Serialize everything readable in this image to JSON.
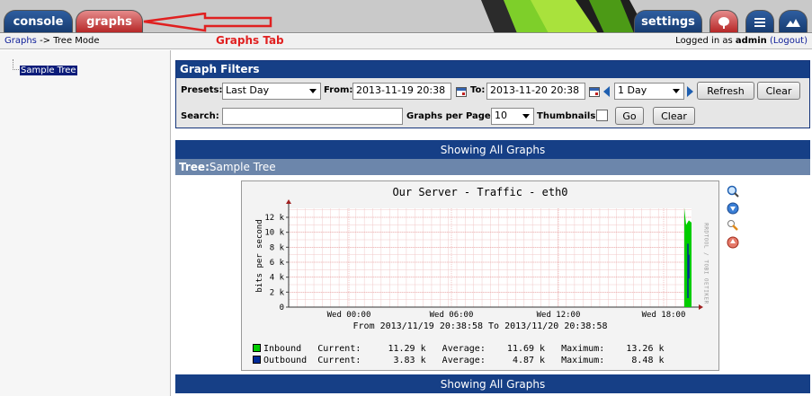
{
  "header": {
    "tabs": {
      "console": "console",
      "graphs": "graphs",
      "settings": "settings"
    },
    "annotation": "Graphs Tab"
  },
  "breadcrumb": {
    "root": "Graphs",
    "separator": "->",
    "current": "Tree Mode"
  },
  "login": {
    "prefix": "Logged in as",
    "user": "admin",
    "logout": "(Logout)"
  },
  "tree": {
    "node": "Sample Tree"
  },
  "filters": {
    "title": "Graph Filters",
    "presets_label": "Presets:",
    "preset_value": "Last Day",
    "from_label": "From:",
    "from_value": "2013-11-19 20:38",
    "to_label": "To:",
    "to_value": "2013-11-20 20:38",
    "shift_value": "1 Day",
    "refresh": "Refresh",
    "clear": "Clear",
    "search_label": "Search:",
    "search_value": "",
    "gpp_label": "Graphs per Page:",
    "gpp_value": "10",
    "thumbnails_label": "Thumbnails:",
    "go": "Go",
    "clear2": "Clear"
  },
  "showing_all": "Showing All Graphs",
  "tree_header": {
    "prefix": "Tree:",
    "name": "Sample Tree"
  },
  "graph": {
    "title": "Our Server - Traffic - eth0",
    "ylabel": "bits per second",
    "watermark": "RRDTOOL / TOBI OETIKER",
    "from_to": "From 2013/11/19 20:38:58 To 2013/11/20 20:38:58",
    "legend": {
      "inbound": "Inbound   Current:     11.29 k   Average:    11.69 k   Maximum:    13.26 k",
      "outbound": "Outbound  Current:      3.83 k   Average:     4.87 k   Maximum:     8.48 k"
    },
    "colors": {
      "inbound": "#00cc00",
      "outbound": "#002a97"
    }
  },
  "chart_data": {
    "type": "area",
    "title": "Our Server - Traffic - eth0",
    "ylabel": "bits per second",
    "xlabel": "",
    "y_ticks": [
      "0",
      "2 k",
      "4 k",
      "6 k",
      "8 k",
      "10 k",
      "12 k"
    ],
    "x_ticks": [
      "Wed 00:00",
      "Wed 06:00",
      "Wed 12:00",
      "Wed 18:00"
    ],
    "ylim": [
      0,
      13000
    ],
    "grid": true,
    "series": [
      {
        "name": "Inbound",
        "color": "#00cc00",
        "current": "11.29 k",
        "average": "11.69 k",
        "maximum": "13.26 k"
      },
      {
        "name": "Outbound",
        "color": "#002a97",
        "current": "3.83 k",
        "average": "4.87 k",
        "maximum": "8.48 k"
      }
    ]
  }
}
